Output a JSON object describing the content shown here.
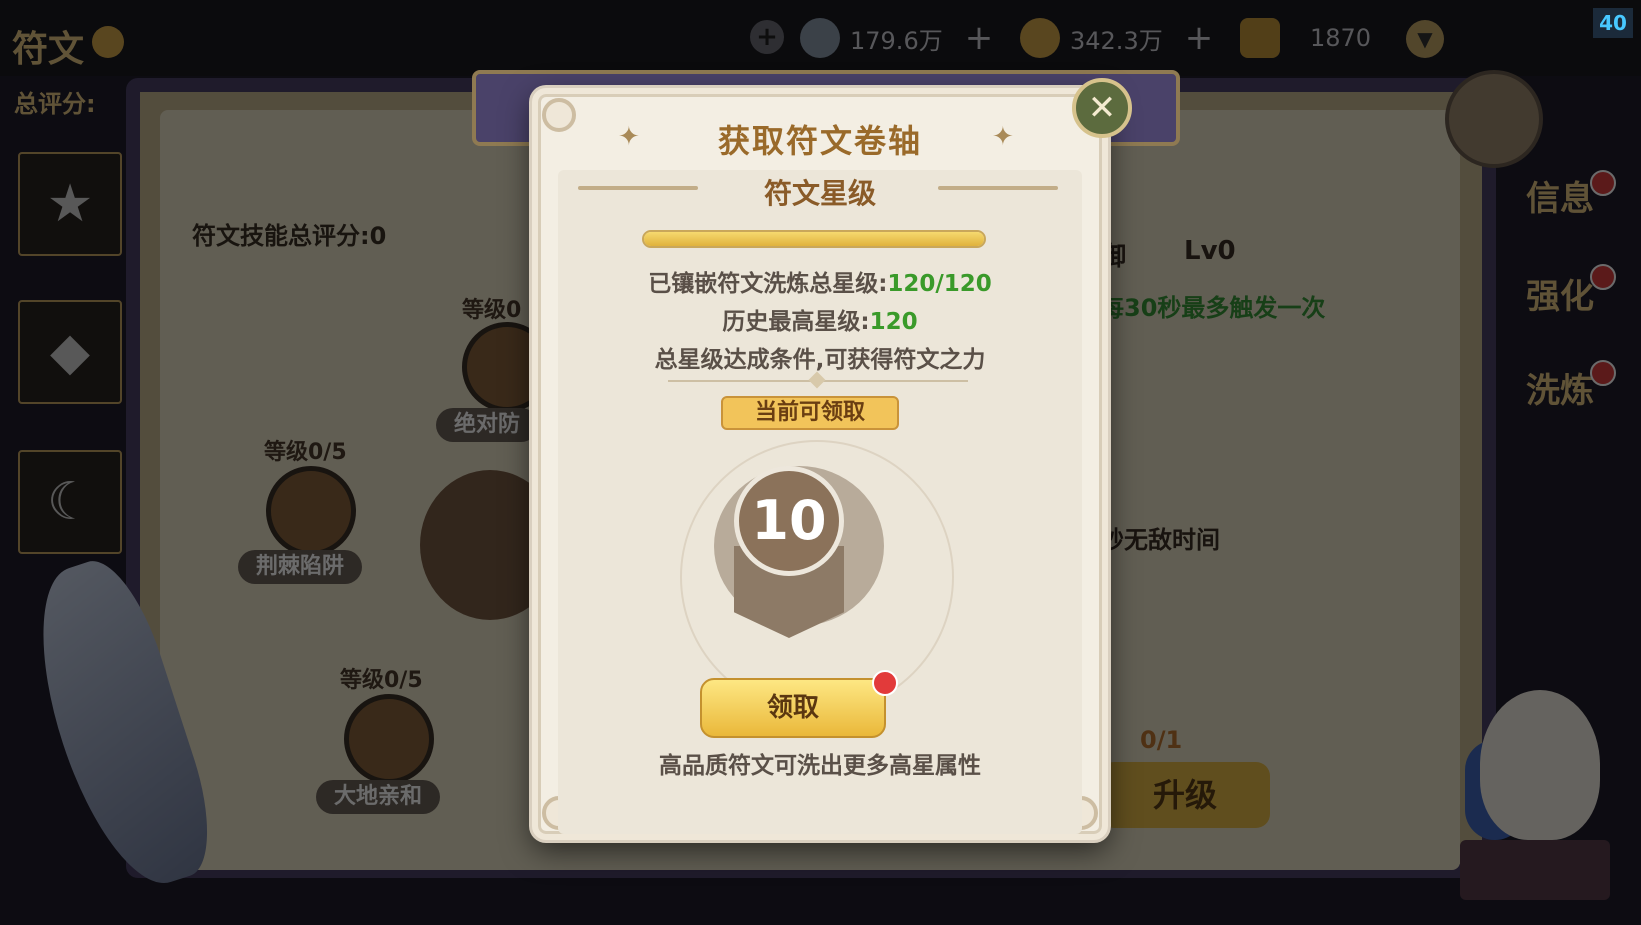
{
  "fps": "40",
  "background": {
    "page_title": "符文",
    "score_label": "总评分:",
    "currencies": [
      {
        "icon": "silver-coin-icon",
        "value": "179.6万",
        "plus": "+"
      },
      {
        "icon": "gold-coin-icon",
        "value": "342.3万",
        "plus": "+"
      },
      {
        "icon": "gem-icon",
        "value": "1870"
      }
    ],
    "rune_skill_score": "符文技能总评分:0",
    "nodes": [
      {
        "level": "等级0",
        "name": "绝对防"
      },
      {
        "level": "等级0/5",
        "name": "荆棘陷阱"
      },
      {
        "level": "等级0/5",
        "name": "大地亲和"
      }
    ],
    "right_panel": {
      "title": "御",
      "level": "Lv0",
      "line1": "每30秒最多触发一次",
      "line2": "秒无敌时间",
      "cost": "0/1",
      "upgrade_label": "升级"
    },
    "side_tabs": [
      "信息",
      "强化",
      "洗炼"
    ]
  },
  "dialog": {
    "title": "获取符文卷轴",
    "section_title": "符文星级",
    "progress_fraction": 1.0,
    "stats": [
      {
        "label": "已镶嵌符文洗炼总星级:",
        "value": "120/120"
      },
      {
        "label": "历史最高星级:",
        "value": "120"
      }
    ],
    "condition_text": "总星级达成条件,可获得符文之力",
    "badge_label": "当前可领取",
    "reward_value": "10",
    "claim_label": "领取",
    "footer_tip": "高品质符文可洗出更多高星属性"
  }
}
